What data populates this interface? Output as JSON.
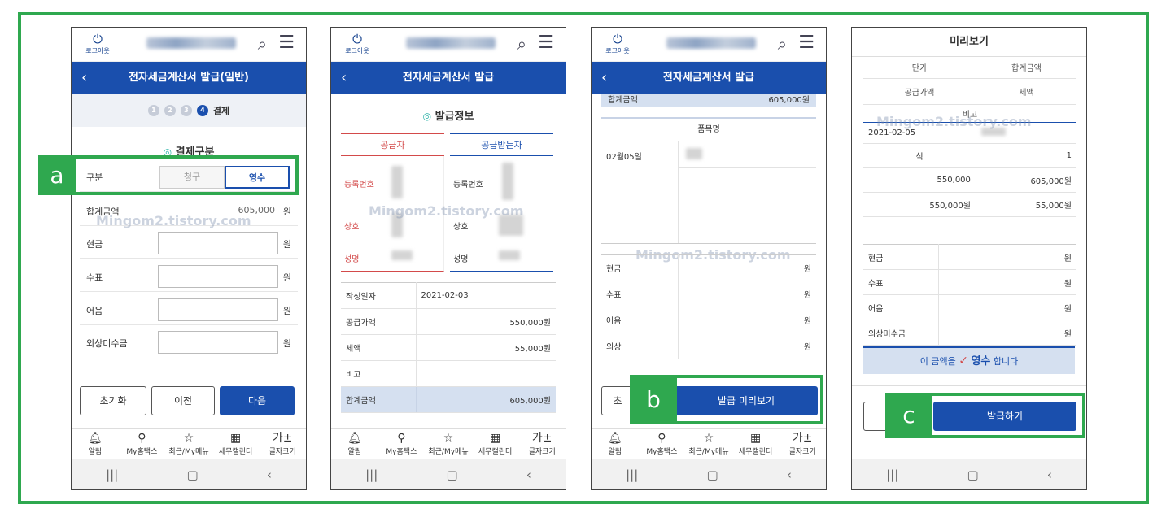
{
  "common": {
    "logout_label": "로그아웃",
    "nav": [
      "알림",
      "My홈택스",
      "최근/My메뉴",
      "세무캘린더",
      "글자크기"
    ],
    "font_icon": "가±",
    "watermark": "Mingom2.tistory.com"
  },
  "p1": {
    "title": "전자세금계산서 발급(일반)",
    "steps": [
      "1",
      "2",
      "3",
      "4"
    ],
    "active_step_label": "결제",
    "section": "결제구분",
    "type_label": "구분",
    "toggle_claim": "청구",
    "toggle_receipt": "영수",
    "total_label": "합계금액",
    "total_value": "605,000",
    "fields": [
      "현금",
      "수표",
      "어음",
      "외상미수금"
    ],
    "unit": "원",
    "btn_reset": "초기화",
    "btn_prev": "이전",
    "btn_next": "다음"
  },
  "p2": {
    "title": "전자세금계산서 발급",
    "section": "발급정보",
    "supplier": "공급자",
    "receiver": "공급받는자",
    "reg_no": "등록번호",
    "biz_name": "상호",
    "person_name": "성명",
    "rows": [
      {
        "label": "작성일자",
        "value": "2021-02-03"
      },
      {
        "label": "공급가액",
        "value": "550,000원"
      },
      {
        "label": "세액",
        "value": "55,000원"
      },
      {
        "label": "비고",
        "value": ""
      },
      {
        "label": "합계금액",
        "value": "605,000원"
      }
    ]
  },
  "p3": {
    "title": "전자세금계산서 발급",
    "partial_total_label": "합계금액",
    "partial_total_value": "605,000원",
    "item_header": "품목명",
    "item_date": "02월05일",
    "pay_rows": [
      "현금",
      "수표",
      "어음",
      "외상"
    ],
    "unit": "원",
    "btn_partial": "초",
    "btn_preview": "발급 미리보기"
  },
  "p4": {
    "title": "미리보기",
    "h_unit_price": "단가",
    "h_total": "합계금액",
    "h_supply": "공급가액",
    "h_tax": "세액",
    "h_note": "비고",
    "date": "2021-02-05",
    "r1_left": "식",
    "r1_right": "1",
    "r2_left": "550,000",
    "r2_right": "605,000원",
    "r3_left": "550,000원",
    "r3_right": "55,000원",
    "pay_rows": [
      "현금",
      "수표",
      "어음",
      "외상미수금"
    ],
    "unit": "원",
    "receipt_pre": "이 금액을",
    "receipt_word": "영수",
    "receipt_post": "합니다",
    "btn_issue": "발급하기"
  },
  "tags": {
    "a": "a",
    "b": "b",
    "c": "c"
  },
  "colors": {
    "primary": "#1a4fad",
    "highlight": "#2fa84f",
    "accent_red": "#d34a4a"
  }
}
